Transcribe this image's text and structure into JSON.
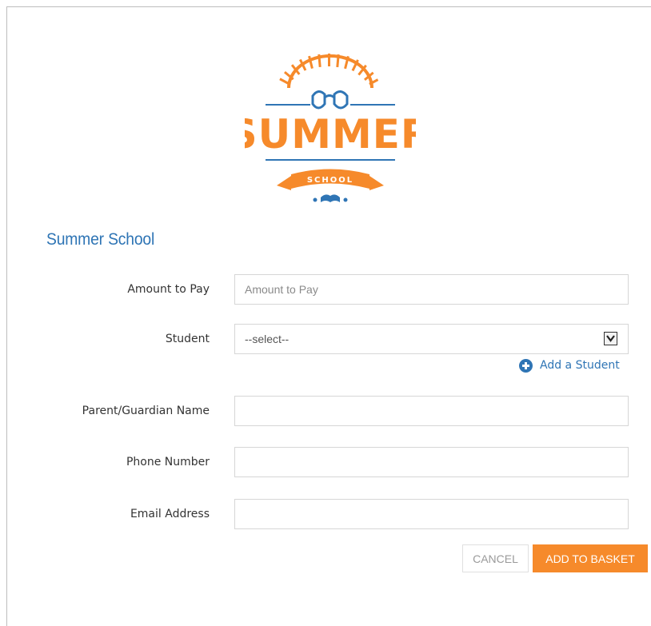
{
  "logo": {
    "main_text": "SUMMER",
    "banner_text": "SCHOOL",
    "colors": {
      "orange": "#f68a2b",
      "blue": "#2f75b5"
    }
  },
  "form": {
    "title": "Summer School",
    "amount": {
      "label": "Amount to Pay",
      "placeholder": "Amount to Pay",
      "value": ""
    },
    "student": {
      "label": "Student",
      "selected": "--select--"
    },
    "add_student": {
      "label": "Add a Student"
    },
    "guardian": {
      "label": "Parent/Guardian Name",
      "value": ""
    },
    "phone": {
      "label": "Phone Number",
      "value": ""
    },
    "email": {
      "label": "Email Address",
      "value": ""
    }
  },
  "actions": {
    "cancel_label": "CANCEL",
    "add_label": "ADD TO BASKET"
  },
  "colors": {
    "accent": "#2f75b5",
    "primary_button": "#f68a2b"
  }
}
